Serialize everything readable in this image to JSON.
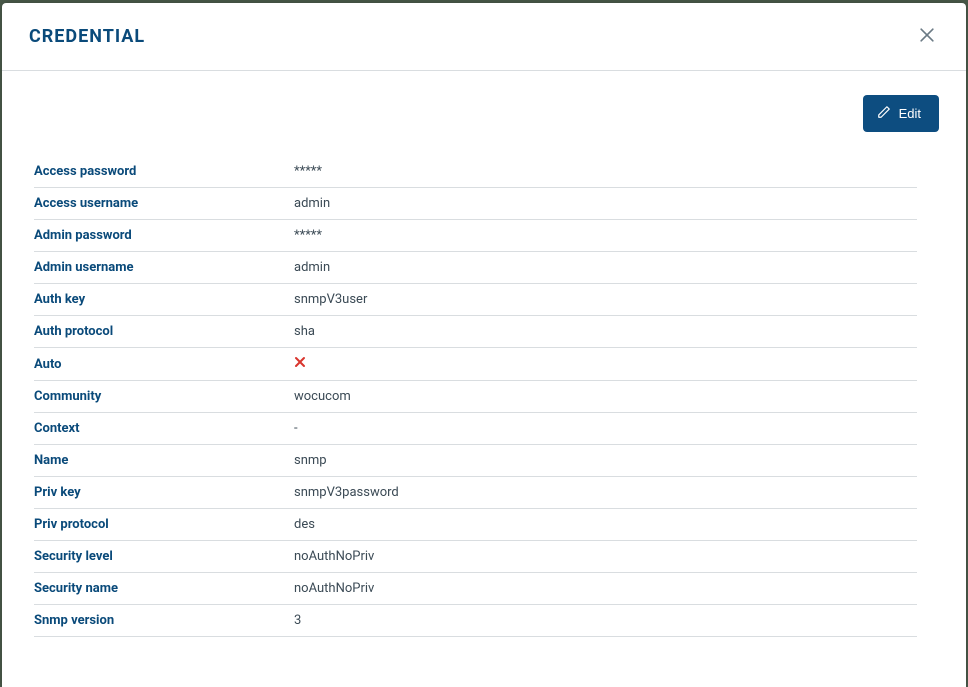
{
  "modal": {
    "title": "CREDENTIAL",
    "edit_label": "Edit"
  },
  "fields": [
    {
      "label": "Access password",
      "value": "*****",
      "type": "text"
    },
    {
      "label": "Access username",
      "value": "admin",
      "type": "text"
    },
    {
      "label": "Admin password",
      "value": "*****",
      "type": "text"
    },
    {
      "label": "Admin username",
      "value": "admin",
      "type": "text"
    },
    {
      "label": "Auth key",
      "value": "snmpV3user",
      "type": "text"
    },
    {
      "label": "Auth protocol",
      "value": "sha",
      "type": "text"
    },
    {
      "label": "Auto",
      "value": false,
      "type": "bool"
    },
    {
      "label": "Community",
      "value": "wocucom",
      "type": "text"
    },
    {
      "label": "Context",
      "value": "-",
      "type": "text"
    },
    {
      "label": "Name",
      "value": "snmp",
      "type": "text"
    },
    {
      "label": "Priv key",
      "value": "snmpV3password",
      "type": "text"
    },
    {
      "label": "Priv protocol",
      "value": "des",
      "type": "text"
    },
    {
      "label": "Security level",
      "value": "noAuthNoPriv",
      "type": "text"
    },
    {
      "label": "Security name",
      "value": "noAuthNoPriv",
      "type": "text"
    },
    {
      "label": "Snmp version",
      "value": "3",
      "type": "text"
    }
  ]
}
